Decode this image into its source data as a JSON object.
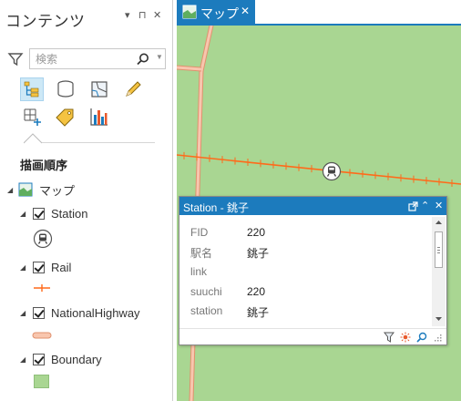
{
  "contents_pane": {
    "title": "コンテンツ",
    "controls": {
      "menu": "▾",
      "pin": "⊓",
      "close": "✕"
    },
    "search": {
      "placeholder": "検索",
      "value": ""
    },
    "draw_order_title": "描画順序",
    "tool_icons": [
      "list-by-drawing-order-icon",
      "list-by-data-source-icon",
      "list-by-selection-icon",
      "list-by-editing-icon",
      "list-by-snapping-icon",
      "list-by-labeling-icon",
      "list-by-charts-icon"
    ],
    "map_layer": {
      "label": "マップ"
    },
    "layers": [
      {
        "label": "Station",
        "symbol": "train-station-icon",
        "checked": true
      },
      {
        "label": "Rail",
        "symbol": "rail-line-symbol",
        "checked": true
      },
      {
        "label": "NationalHighway",
        "symbol": "highway-line-symbol",
        "checked": true
      },
      {
        "label": "Boundary",
        "symbol": "polygon-fill-symbol",
        "checked": true
      }
    ]
  },
  "map_tab": {
    "label": "マップ",
    "close": "✕"
  },
  "colors": {
    "accent": "#1c7bbd",
    "map_fill": "#a9d692",
    "rail": "#ff6a1a",
    "highway": "#f8c6ae",
    "boundary_fill": "#a9d692"
  },
  "popup": {
    "title": "Station - 銚子",
    "attributes": [
      {
        "name": "FID",
        "value": "220"
      },
      {
        "name": "駅名",
        "value": "銚子"
      },
      {
        "name": "link",
        "value": ""
      },
      {
        "name": "suuchi",
        "value": "220"
      },
      {
        "name": "station",
        "value": "銚子"
      }
    ],
    "footer_icons": [
      "filter-icon",
      "flash-icon",
      "zoom-to-icon",
      "resize-grip-icon"
    ]
  }
}
